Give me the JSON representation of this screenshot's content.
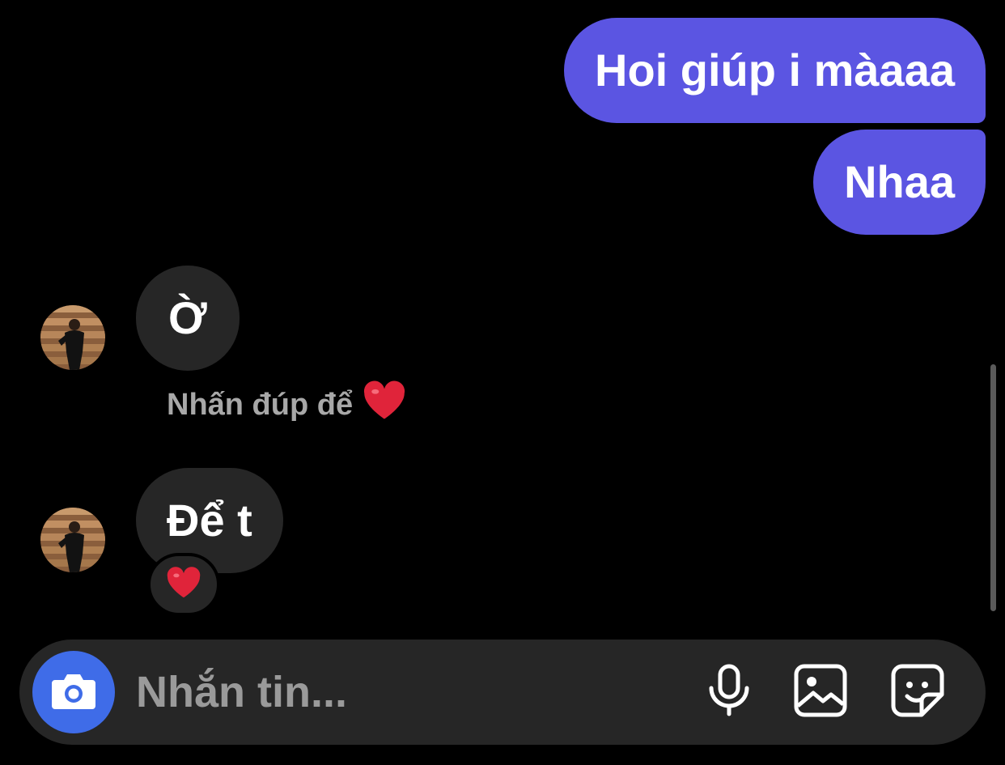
{
  "messages_out": [
    {
      "text": "Hoi giúp i màaaa"
    },
    {
      "text": "Nhaa"
    }
  ],
  "messages_in": [
    {
      "text": "Ờ"
    },
    {
      "text": "Để t"
    }
  ],
  "hint": {
    "text": "Nhấn đúp để",
    "icon": "heart-icon"
  },
  "reaction": {
    "icon": "heart-icon"
  },
  "composer": {
    "placeholder": "Nhắn tin...",
    "value": "",
    "icons": [
      "camera-icon",
      "microphone-icon",
      "gallery-icon",
      "sticker-icon"
    ]
  },
  "colors": {
    "outgoing_bubble": "#5b55e2",
    "incoming_bubble": "#262626",
    "camera_button": "#3f6ce8",
    "heart": "#e0243a"
  }
}
